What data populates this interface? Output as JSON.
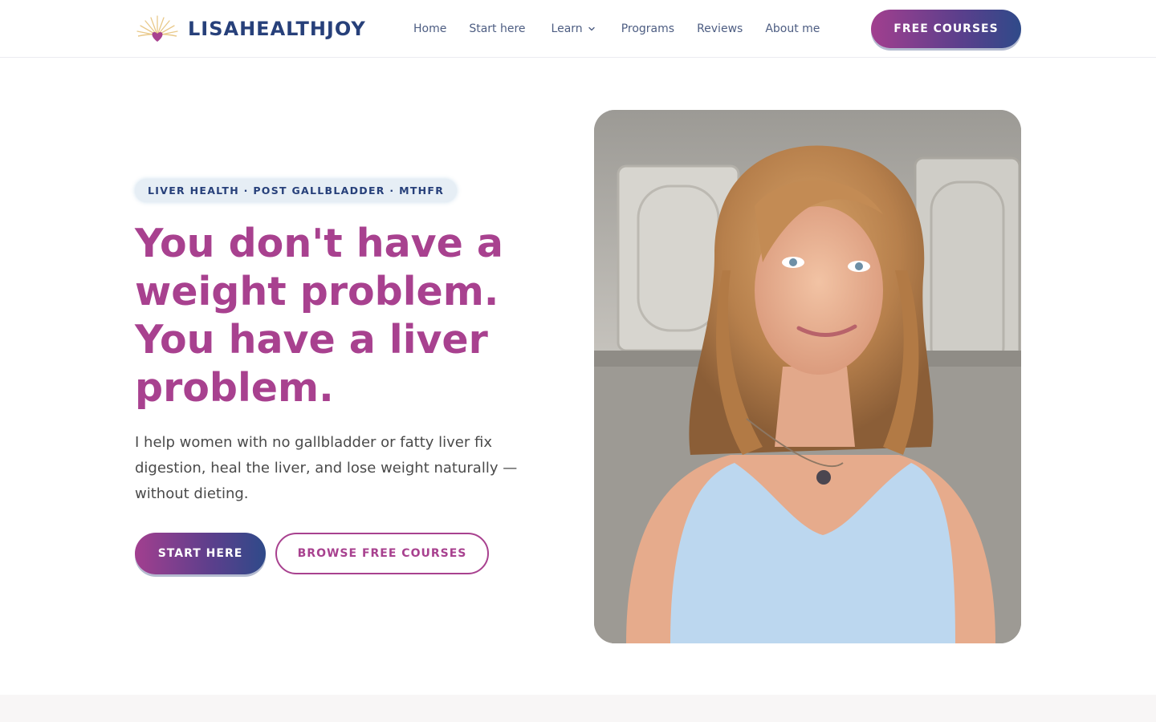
{
  "brand": {
    "name": "LISAHEALTHJOY",
    "logo_icon": "sunrise-heart-icon",
    "colors": {
      "primary": "#a8418f",
      "navy": "#27407a",
      "gradient_end": "#2f4a89"
    }
  },
  "nav": {
    "items": [
      {
        "label": "Home"
      },
      {
        "label": "Start here"
      },
      {
        "label": "Learn",
        "icon": "chevron-down-icon"
      },
      {
        "label": "Programs"
      },
      {
        "label": "Reviews"
      },
      {
        "label": "About me"
      }
    ],
    "cta": "FREE COURSES"
  },
  "hero": {
    "tag": "LIVER HEALTH · POST GALLBLADDER · MTHFR",
    "headline": "You don't have a weight problem. You have a liver problem.",
    "subtext": "I help women with no gallbladder or fatty liver fix digestion, heal the liver, and lose weight naturally — without dieting.",
    "primary_button": "START HERE",
    "secondary_button": "BROWSE FREE COURSES",
    "image": "portrait-photo"
  }
}
